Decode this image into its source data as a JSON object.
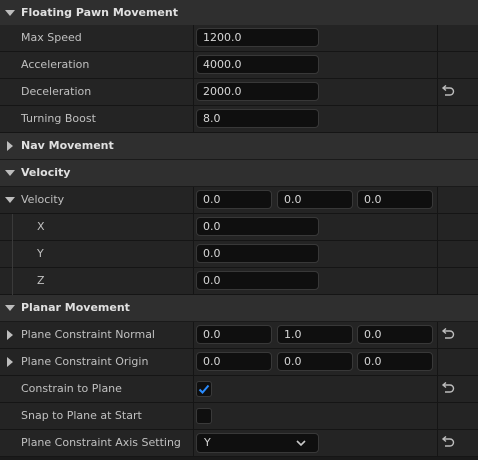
{
  "sections": {
    "floating_pawn_movement": {
      "title": "Floating Pawn Movement",
      "max_speed": {
        "label": "Max Speed",
        "value": "1200.0"
      },
      "acceleration": {
        "label": "Acceleration",
        "value": "4000.0"
      },
      "deceleration": {
        "label": "Deceleration",
        "value": "2000.0"
      },
      "turning_boost": {
        "label": "Turning Boost",
        "value": "8.0"
      }
    },
    "nav_movement": {
      "title": "Nav Movement"
    },
    "velocity": {
      "title": "Velocity",
      "velocity": {
        "label": "Velocity",
        "x": "0.0",
        "y": "0.0",
        "z": "0.0"
      },
      "x": {
        "label": "X",
        "value": "0.0"
      },
      "y": {
        "label": "Y",
        "value": "0.0"
      },
      "z": {
        "label": "Z",
        "value": "0.0"
      }
    },
    "planar_movement": {
      "title": "Planar Movement",
      "plane_constraint_normal": {
        "label": "Plane Constraint Normal",
        "x": "0.0",
        "y": "1.0",
        "z": "0.0"
      },
      "plane_constraint_origin": {
        "label": "Plane Constraint Origin",
        "x": "0.0",
        "y": "0.0",
        "z": "0.0"
      },
      "constrain_to_plane": {
        "label": "Constrain to Plane",
        "checked": true
      },
      "snap_to_plane_at_start": {
        "label": "Snap to Plane at Start",
        "checked": false
      },
      "plane_constraint_axis_setting": {
        "label": "Plane Constraint Axis Setting",
        "value": "Y"
      }
    }
  },
  "colors": {
    "accent_check": "#2a8cff",
    "field_bg": "#0f0f0f",
    "row_bg": "#242424",
    "category_bg": "#2f2f2f"
  },
  "icons": {
    "expand": "triangle-down-icon",
    "collapse": "triangle-right-icon",
    "reset": "reset-arrow-icon",
    "dropdown": "chevron-down-icon",
    "check": "checkmark-icon"
  }
}
